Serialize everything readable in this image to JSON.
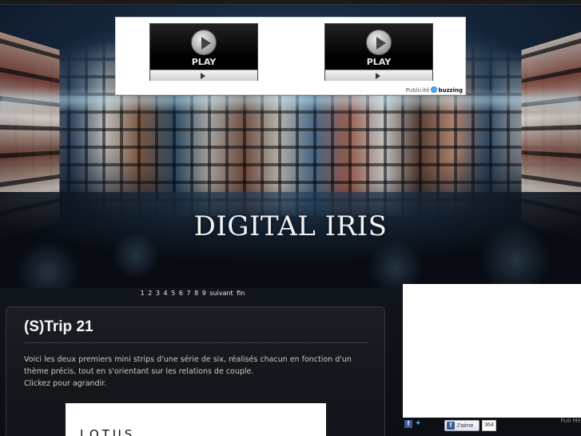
{
  "ad": {
    "video_1": {
      "play_label": "PLAY"
    },
    "video_2": {
      "play_label": "PLAY"
    },
    "credit_prefix": "Publicité",
    "credit_brand": "buzzing"
  },
  "site": {
    "title": "DIGITAL IRIS"
  },
  "pagination": {
    "pages": [
      "1",
      "2",
      "3",
      "4",
      "5",
      "6",
      "7",
      "8",
      "9"
    ],
    "next_label": "suivant",
    "last_label": "fin"
  },
  "post": {
    "title": "(S)Trip 21",
    "body_line_1": "Voici les deux premiers mini strips d'une série de six, réalisés chacun en fonction d'un",
    "body_line_2": "thème précis, tout en s'orientant sur les relations de couple.",
    "body_line_3": "Clickez pour agrandir.",
    "image_text": "LOTUS"
  },
  "social": {
    "like_label": "J'aime",
    "like_count": "364",
    "pub_label": "Pub Mé"
  },
  "icons": {
    "facebook": "facebook-icon",
    "twitter": "twitter-icon",
    "play": "play-icon"
  }
}
